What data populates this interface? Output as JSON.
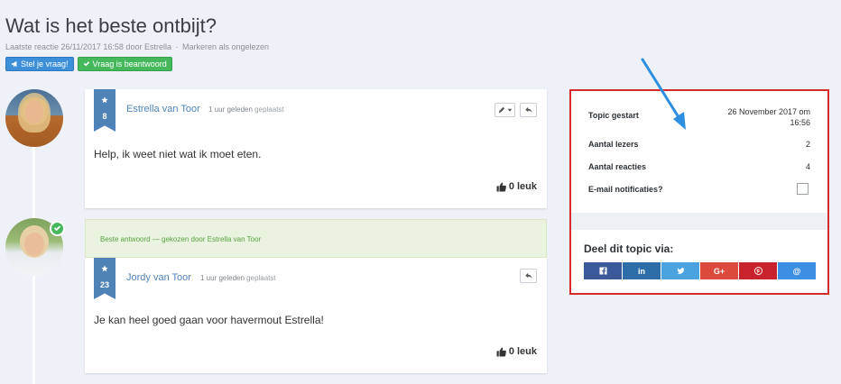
{
  "page": {
    "title": "Wat is het beste ontbijt?",
    "meta_last_reply": "Laatste reactie 26/11/2017 16:58 door Estrella",
    "meta_separator": "·",
    "meta_mark_unread": "Markeren als ongelezen"
  },
  "buttons": {
    "ask_question": "Stel je vraag!",
    "answered": "Vraag is beantwoord"
  },
  "posts": [
    {
      "author": "Estrella van Toor",
      "time": "1 uur geleden",
      "time_suffix": "geplaatst",
      "rank": "8",
      "text": "Help, ik weet niet wat ik moet eten.",
      "likes": "0 leuk"
    },
    {
      "author": "Jordy van Toor",
      "time": "1 uur geleden",
      "time_suffix": "geplaatst",
      "rank": "23",
      "text": "Je kan heel goed gaan voor havermout Estrella!",
      "likes": "0 leuk"
    }
  ],
  "best_answer": "Beste antwoord — gekozen door Estrella van Toor",
  "topic_info": {
    "started_label": "Topic gestart",
    "started_value_line1": "26 November 2017 om",
    "started_value_line2": "16:56",
    "readers_label": "Aantal lezers",
    "readers_value": "2",
    "replies_label": "Aantal reacties",
    "replies_value": "4",
    "email_label": "E-mail notificaties?"
  },
  "share": {
    "title": "Deel dit topic via:",
    "buttons": [
      {
        "icon": "facebook-icon",
        "label": "",
        "color": "#3b5998"
      },
      {
        "icon": "linkedin-icon",
        "label": "in",
        "color": "#2e6ea8"
      },
      {
        "icon": "twitter-icon",
        "label": "",
        "color": "#4aa3df"
      },
      {
        "icon": "google-plus-icon",
        "label": "G+",
        "color": "#dc4a3d"
      },
      {
        "icon": "pinterest-icon",
        "label": "",
        "color": "#c8232c"
      },
      {
        "icon": "email-icon",
        "label": "@",
        "color": "#3d8fe4"
      }
    ]
  },
  "colors": {
    "accent": "#4f83b8",
    "highlight_border": "#d62b2b",
    "annotation_arrow": "#2e8fe0",
    "success": "#46b85c"
  }
}
